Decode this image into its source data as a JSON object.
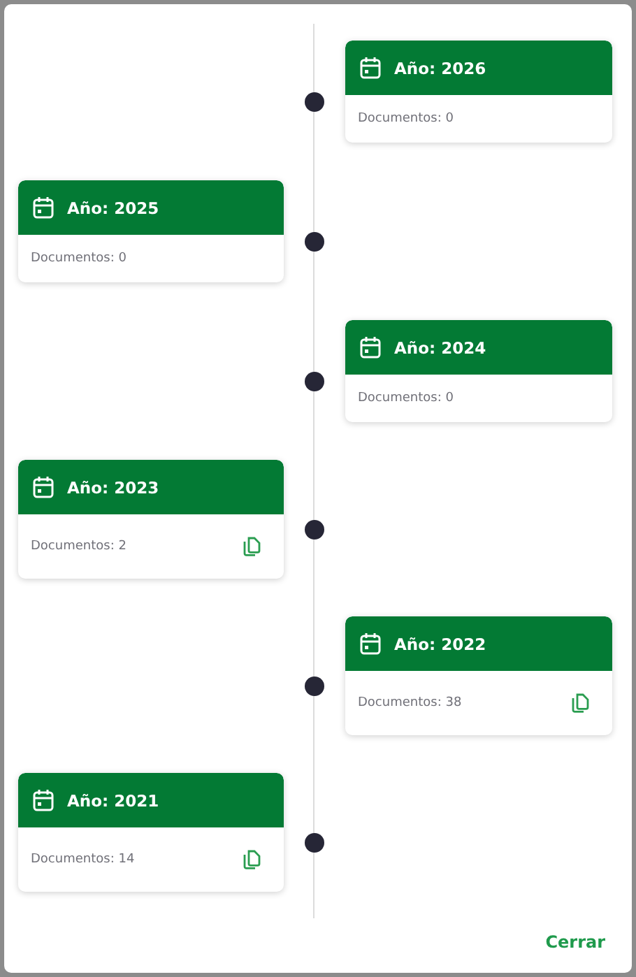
{
  "entries": [
    {
      "kind": "right",
      "title": "Año: 2026",
      "documents": "Documentos: 0",
      "copy_action": false
    },
    {
      "kind": "left",
      "title": "Año: 2025",
      "documents": "Documentos: 0",
      "copy_action": false
    },
    {
      "kind": "right",
      "title": "Año: 2024",
      "documents": "Documentos: 0",
      "copy_action": false
    },
    {
      "kind": "left",
      "title": "Año: 2023",
      "documents": "Documentos: 2",
      "copy_action": true
    },
    {
      "kind": "right",
      "title": "Año: 2022",
      "documents": "Documentos: 38",
      "copy_action": true
    },
    {
      "kind": "left",
      "title": "Año: 2021",
      "documents": "Documentos: 14",
      "copy_action": true
    }
  ],
  "close_button": "Cerrar"
}
